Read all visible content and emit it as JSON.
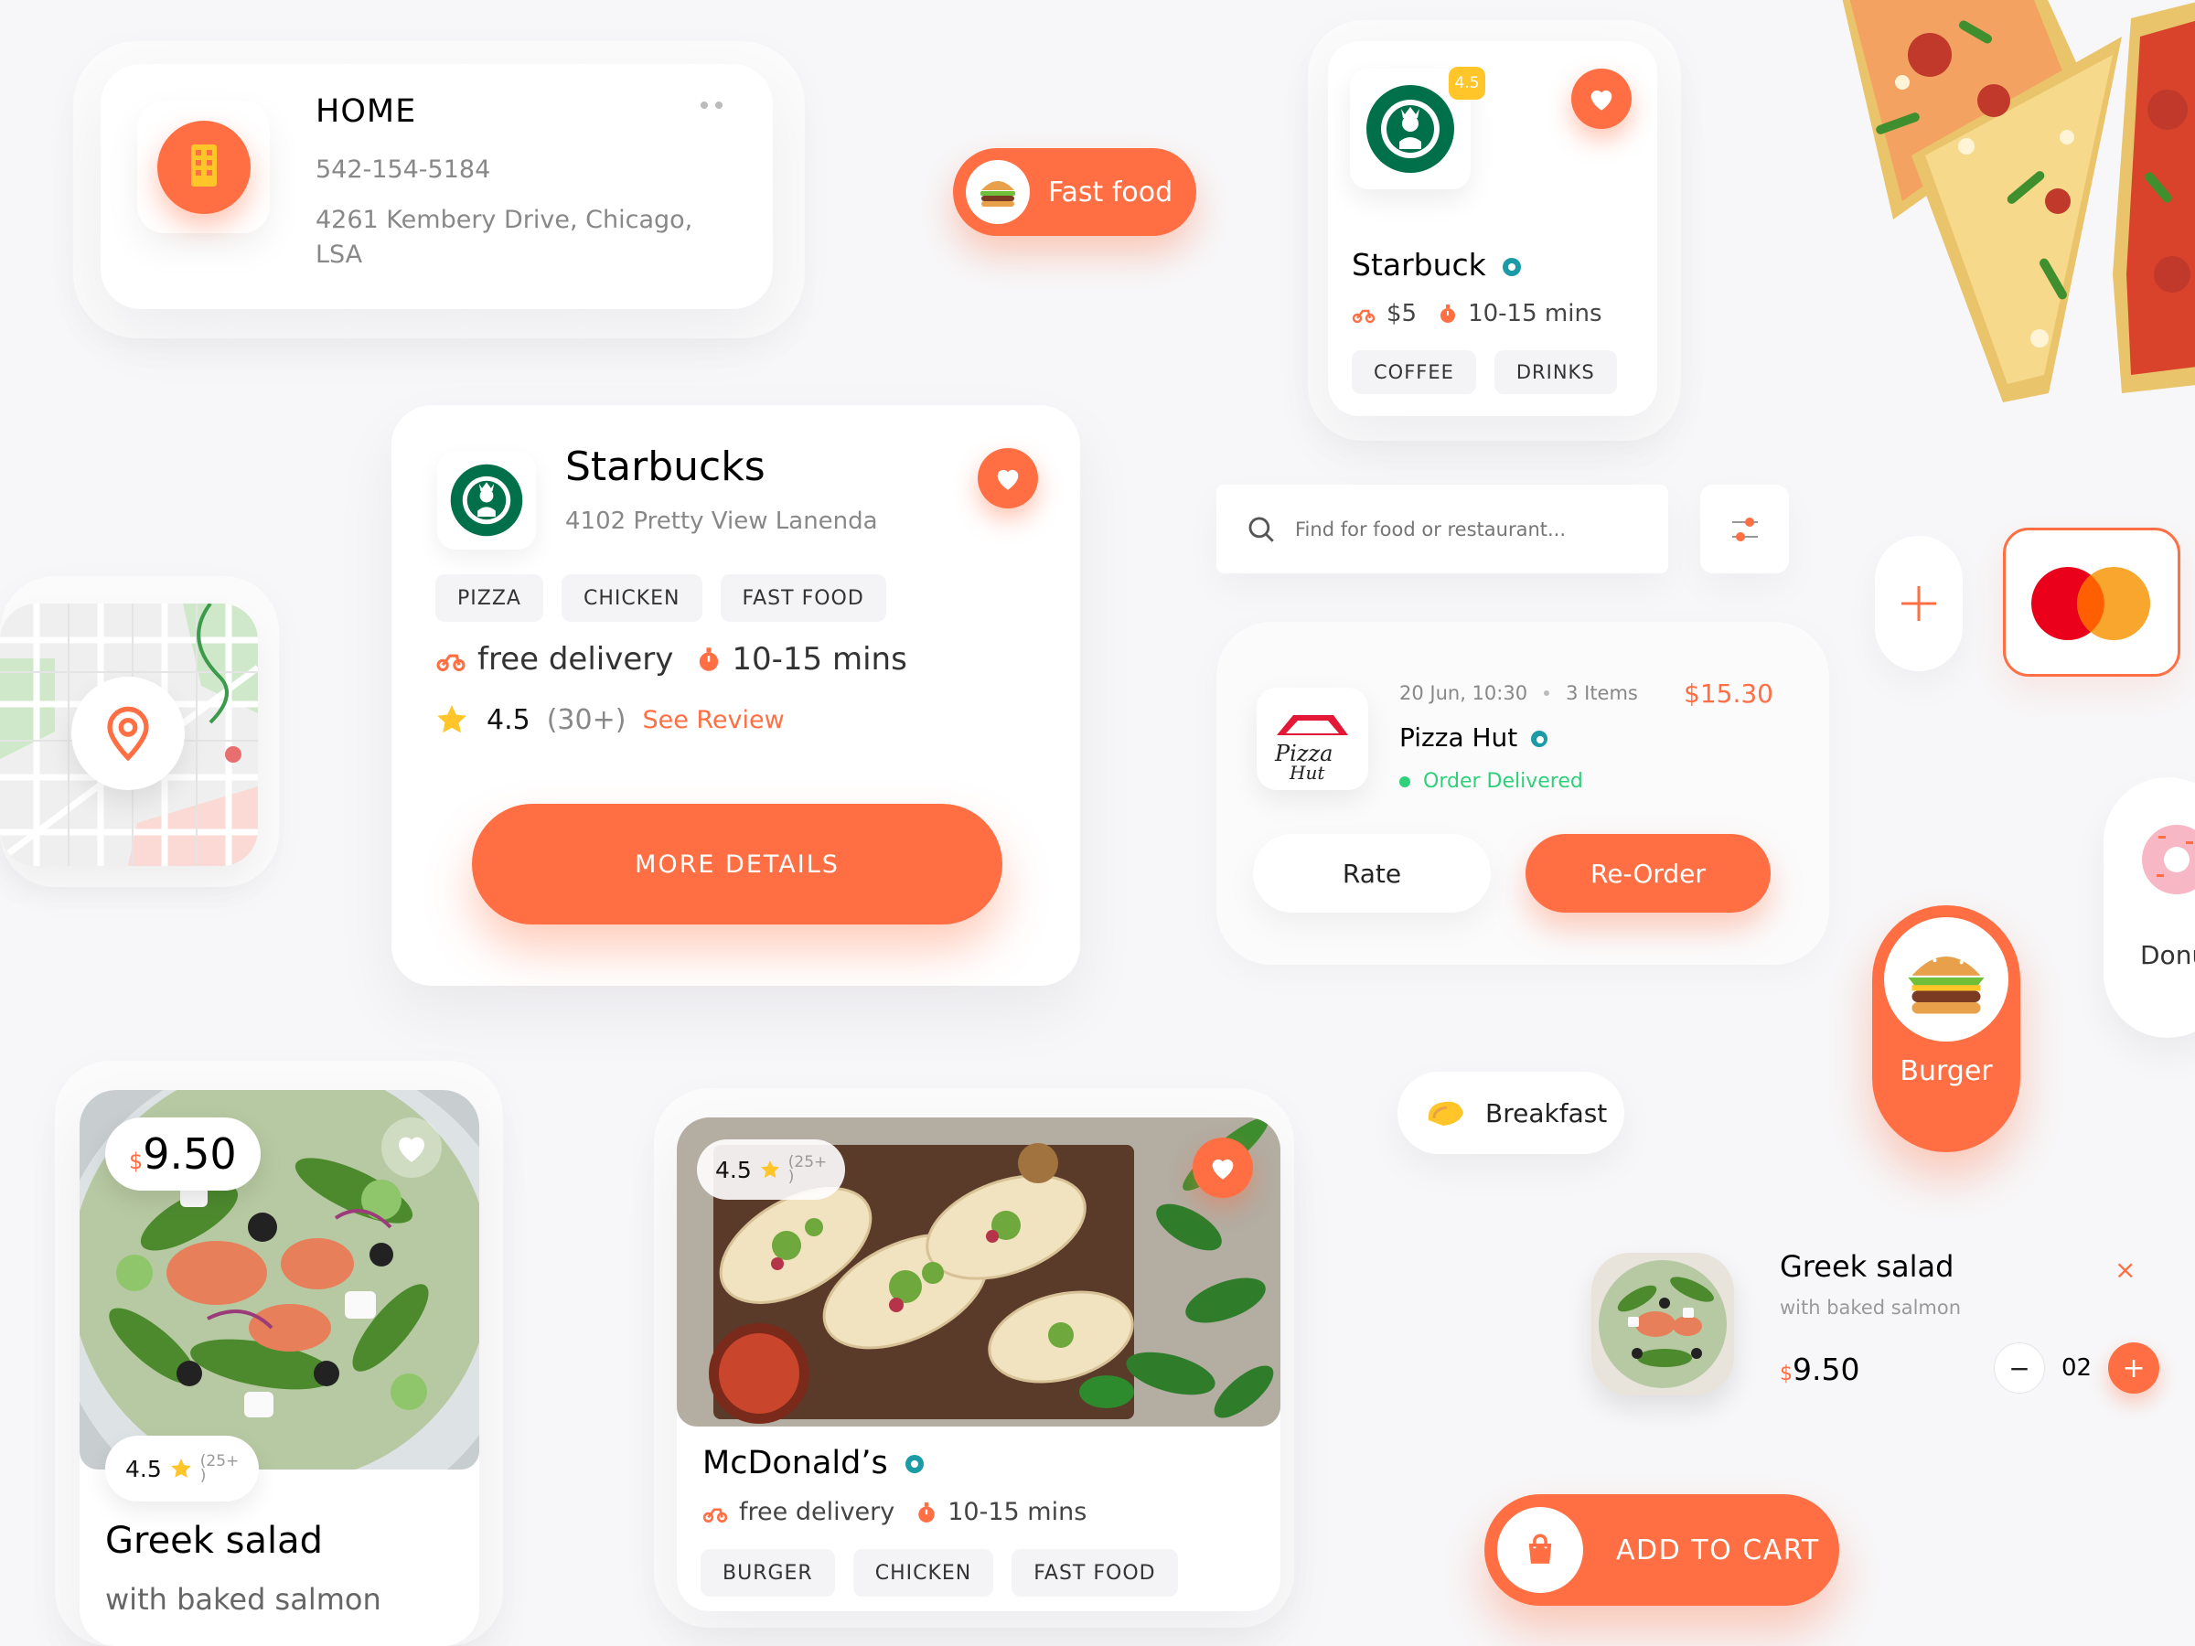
{
  "address_card": {
    "title": "HOME",
    "phone": "542-154-5184",
    "address": "4261 Kembery Drive, Chicago, LSA",
    "more_icon": "more-dots-icon",
    "building_icon": "building-icon"
  },
  "category_fast_food": {
    "label": "Fast food"
  },
  "starbuck_mini": {
    "name": "Starbuck",
    "rating_badge": "4.5",
    "price": "$5",
    "time": "10-15 mins",
    "tags": [
      "COFFEE",
      "DRINKS"
    ]
  },
  "starbucks_card": {
    "name": "Starbucks",
    "address": "4102  Pretty View Lanenda",
    "tags": [
      "PIZZA",
      "CHICKEN",
      "FAST FOOD"
    ],
    "delivery": "free delivery",
    "time": "10-15 mins",
    "rating": "4.5",
    "reviews": "(30+)",
    "see_review": "See Review",
    "button": "MORE DETAILS"
  },
  "search": {
    "placeholder": "Find for food or restaurant..."
  },
  "order_card": {
    "date": "20 Jun, 10:30",
    "items": "3 Items",
    "price": "$15.30",
    "name": "Pizza Hut",
    "status": "Order Delivered",
    "rate_label": "Rate",
    "reorder_label": "Re-Order"
  },
  "donut_label": "Donu",
  "burger_category": {
    "label": "Burger"
  },
  "breakfast_category": {
    "label": "Breakfast"
  },
  "salad_card": {
    "currency": "$",
    "price": "9.50",
    "rating": "4.5",
    "reviews": "(25+",
    "reviews_close": ")",
    "title": "Greek salad",
    "subtitle": "with baked salmon"
  },
  "mcd_card": {
    "rating": "4.5",
    "reviews": "(25+",
    "reviews_close": ")",
    "name": "McDonald’s",
    "delivery": "free delivery",
    "time": "10-15 mins",
    "tags": [
      "BURGER",
      "CHICKEN",
      "FAST FOOD"
    ]
  },
  "cart_item": {
    "title": "Greek salad",
    "subtitle": "with baked salmon",
    "currency": "$",
    "price": "9.50",
    "quantity": "02",
    "minus": "−",
    "plus": "+",
    "close": "×"
  },
  "add_to_cart": {
    "label": "ADD TO CART"
  },
  "colors": {
    "accent": "#ff6f43",
    "verified": "#1a9ba6",
    "delivered": "#2fd07a",
    "star": "#ffc529"
  }
}
